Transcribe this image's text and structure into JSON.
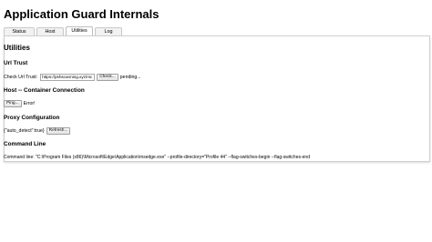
{
  "page": {
    "title": "Application Guard Internals"
  },
  "tabs": [
    {
      "label": "Status",
      "active": false
    },
    {
      "label": "Host",
      "active": false
    },
    {
      "label": "Utilities",
      "active": true
    },
    {
      "label": "Log",
      "active": false
    }
  ],
  "utilities": {
    "heading": "Utilities",
    "url_trust": {
      "heading": "Url Trust",
      "label": "Check Url Trust:",
      "input_value": "https://pshscanning.xyz/mc",
      "button_label": "Check...",
      "status": "pending..."
    },
    "host_connection": {
      "heading": "Host -- Container Connection",
      "button_label": "Ping...",
      "status": "Error!"
    },
    "proxy": {
      "heading": "Proxy Configuration",
      "value": "{\"auto_detect\":true}",
      "button_label": "Refresh..."
    },
    "command_line": {
      "heading": "Command Line",
      "text": "Command line: \"C:\\Program Files (x86)\\Microsoft\\Edge\\Application\\msedge.exe\" --profile-directory=\"Profile 44\" --flag-switches-begin --flag-switches-end"
    }
  }
}
